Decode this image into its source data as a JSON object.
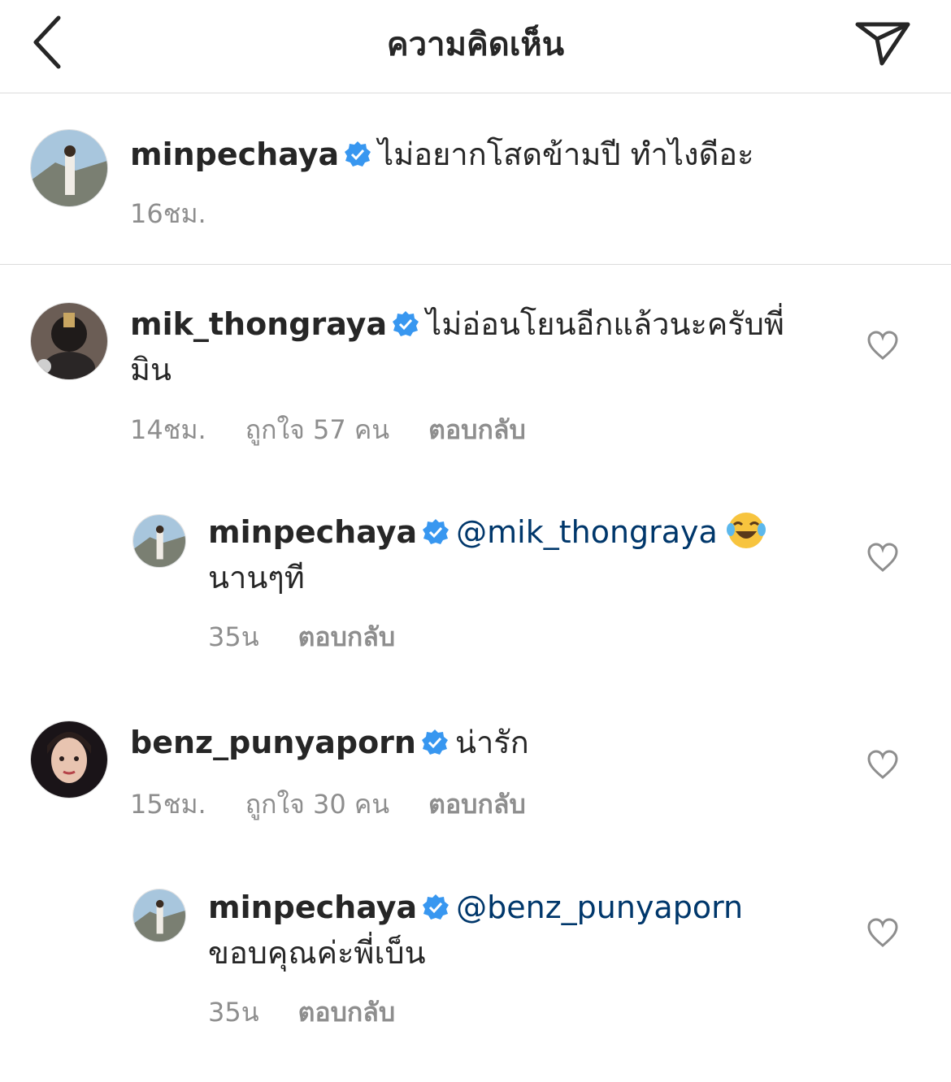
{
  "header": {
    "title": "ความคิดเห็น"
  },
  "caption": {
    "username": "minpechaya",
    "text": "ไม่อยากโสดข้ามปี  ทำไงดีอะ",
    "time": "16ชม."
  },
  "comments": [
    {
      "username": "mik_thongraya",
      "text": "ไม่อ่อนโยนอีกแล้วนะครับพี่มิน",
      "time": "14ชม.",
      "likes": "ถูกใจ 57 คน",
      "reply": "ตอบกลับ"
    },
    {
      "username": "minpechaya",
      "mention": "@mik_thongraya",
      "text": "นานๆที",
      "time": "35น",
      "reply": "ตอบกลับ"
    },
    {
      "username": "benz_punyaporn",
      "text": "น่ารัก",
      "time": "15ชม.",
      "likes": "ถูกใจ 30 คน",
      "reply": "ตอบกลับ"
    },
    {
      "username": "minpechaya",
      "mention": "@benz_punyaporn",
      "text": "ขอบคุณค่ะพี่เบ็น",
      "time": "35น",
      "reply": "ตอบกลับ"
    }
  ],
  "icons": {
    "back": "chevron-left-icon",
    "send": "paper-plane-icon",
    "verified": "verified-badge-icon",
    "like": "heart-outline-icon",
    "emoji": "tears-of-joy-emoji"
  },
  "colors": {
    "verified": "#3897f0",
    "mention": "#00376b",
    "meta": "#8e8e8e",
    "divider": "#dbdbdb"
  }
}
